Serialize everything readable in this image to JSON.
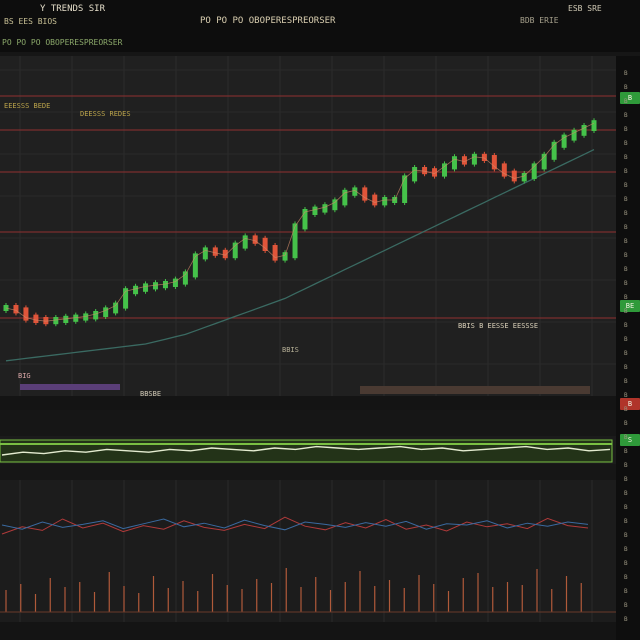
{
  "header": {
    "title": "Y TRENDS SIR",
    "subtitle": "BS EES BIOS",
    "line3": "PO PO  PO OBOPERESPREORSER",
    "right_label": "ESB SRE",
    "right_sub": "BDB ERIE"
  },
  "annotations": {
    "upper_left": "EEESSS BEDE",
    "upper_mid": "DEESSS REDES",
    "lower_right": "BBIS B EESSE EESSSE",
    "mid_label": "BBIS",
    "lower_left": "BIG",
    "lower_mid": "BBSBE"
  },
  "right_rail": {
    "tags": [
      {
        "label": "B",
        "color": "#2f9a3a"
      },
      {
        "label": "BE",
        "color": "#2f9a3a"
      },
      {
        "label": "B",
        "color": "#b0342a"
      },
      {
        "label": "S",
        "color": "#2f9a3a"
      }
    ],
    "ticks": [
      "B",
      "B",
      "B",
      "B",
      "B",
      "B",
      "B",
      "B",
      "B",
      "B",
      "B",
      "B",
      "B",
      "B",
      "B",
      "B",
      "B",
      "B",
      "B",
      "B",
      "B",
      "B",
      "B",
      "B",
      "B",
      "B",
      "B",
      "B",
      "B",
      "B",
      "B",
      "B",
      "B",
      "B",
      "B",
      "B",
      "B",
      "B",
      "B",
      "B"
    ]
  },
  "colors": {
    "bull": "#45c24a",
    "bear": "#e0553a",
    "ma_slow": "#3a6a62",
    "ma_fast": "#a07050",
    "hline": "#7a2e2e",
    "band": "#7ac043"
  },
  "chart_data": [
    {
      "type": "line",
      "subtype": "candlestick-price",
      "x": [
        "0",
        "1",
        "2",
        "3",
        "4",
        "5",
        "6",
        "7",
        "8",
        "9",
        "10",
        "11",
        "12",
        "13",
        "14",
        "15",
        "16",
        "17",
        "18",
        "19",
        "20",
        "21",
        "22",
        "23",
        "24",
        "25",
        "26",
        "27",
        "28",
        "29",
        "30",
        "31",
        "32",
        "33",
        "34",
        "35",
        "36",
        "37",
        "38",
        "39",
        "40",
        "41",
        "42",
        "43",
        "44",
        "45",
        "46",
        "47",
        "48",
        "49",
        "50",
        "51",
        "52",
        "53",
        "54",
        "55",
        "56",
        "57",
        "58",
        "59"
      ],
      "series": [
        {
          "name": "",
          "values": [
            60,
            58,
            52,
            50,
            49,
            50,
            51,
            52,
            53,
            55,
            58,
            62,
            74,
            76,
            78,
            79,
            80,
            82,
            88,
            103,
            108,
            106,
            104,
            112,
            118,
            116,
            110,
            102,
            104,
            128,
            140,
            142,
            144,
            148,
            156,
            158,
            152,
            148,
            150,
            150,
            168,
            175,
            174,
            172,
            178,
            184,
            182,
            186,
            185,
            178,
            172,
            168,
            170,
            178,
            186,
            196,
            202,
            206,
            210,
            214
          ]
        },
        {
          "name": "",
          "values": [
            16,
            17,
            18,
            19,
            20,
            21,
            22,
            23,
            24,
            25,
            26,
            27,
            28,
            29,
            30,
            32,
            34,
            36,
            38,
            41,
            44,
            47,
            50,
            53,
            56,
            59,
            62,
            65,
            68,
            72,
            76,
            80,
            84,
            88,
            92,
            96,
            100,
            104,
            108,
            112,
            116,
            120,
            124,
            128,
            132,
            136,
            140,
            144,
            148,
            152,
            156,
            160,
            164,
            168,
            172,
            176,
            180,
            184,
            188,
            192
          ]
        }
      ],
      "ylim": [
        0,
        250
      ],
      "grid": true
    },
    {
      "type": "area",
      "subtype": "indicator-band",
      "values": [
        60,
        62,
        61,
        63,
        62,
        64,
        63,
        62,
        64,
        63,
        65,
        64,
        63,
        65,
        64,
        66,
        65,
        64,
        65,
        66,
        64,
        65,
        63,
        64,
        65,
        66,
        64,
        65,
        63,
        64
      ]
    },
    {
      "type": "line",
      "subtype": "oscillator",
      "series": [
        {
          "name": "",
          "values": [
            30,
            42,
            36,
            55,
            40,
            48,
            34,
            44,
            38,
            52,
            41,
            36,
            46,
            39,
            58,
            43,
            37,
            49,
            40,
            54,
            38,
            45,
            35,
            50,
            42,
            47,
            39,
            56,
            44,
            40
          ]
        },
        {
          "name": "",
          "values": [
            45,
            38,
            50,
            41,
            46,
            52,
            39,
            47,
            55,
            42,
            48,
            40,
            53,
            44,
            37,
            50,
            46,
            41,
            49,
            43,
            51,
            38,
            47,
            45,
            52,
            40,
            48,
            43,
            50,
            46
          ]
        }
      ],
      "ylim": [
        0,
        100
      ]
    },
    {
      "type": "bar",
      "subtype": "volume-spikes",
      "values": [
        22,
        28,
        18,
        34,
        25,
        30,
        20,
        40,
        26,
        19,
        36,
        24,
        31,
        21,
        38,
        27,
        23,
        33,
        29,
        44,
        25,
        35,
        22,
        30,
        41,
        26,
        32,
        24,
        37,
        28,
        21,
        34,
        39,
        25,
        30,
        27,
        43,
        23,
        36,
        29
      ]
    }
  ]
}
